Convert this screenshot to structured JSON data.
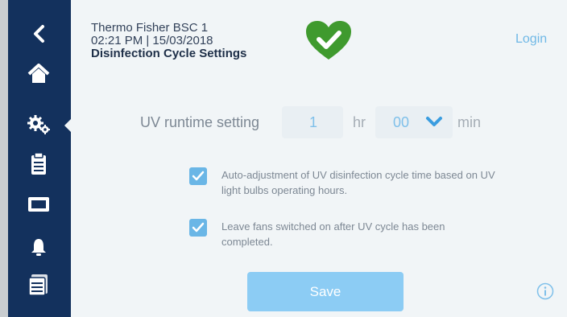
{
  "header": {
    "device_name": "Thermo Fisher BSC 1",
    "datetime": "02:21 PM | 15/03/2018",
    "page_title": "Disinfection Cycle Settings",
    "login": "Login"
  },
  "sidebar": {
    "items": [
      {
        "icon": "back-chevron-icon"
      },
      {
        "icon": "home-icon"
      },
      {
        "icon": "settings-gears-icon",
        "selected": true
      },
      {
        "icon": "clipboard-icon"
      },
      {
        "icon": "display-icon"
      },
      {
        "icon": "bell-icon"
      },
      {
        "icon": "files-icon"
      }
    ]
  },
  "uv_runtime": {
    "label": "UV runtime setting",
    "hours_value": "1",
    "hours_unit": "hr",
    "minutes_value": "00",
    "minutes_unit": "min"
  },
  "options": {
    "auto_adjust": {
      "checked": true,
      "text": "Auto-adjustment of UV disinfection cycle time based on UV light bulbs operating hours."
    },
    "leave_fans_on": {
      "checked": true,
      "text": "Leave fans switched on after UV cycle has been completed."
    }
  },
  "actions": {
    "save_label": "Save"
  },
  "colors": {
    "sidebar": "#13315d",
    "accent_blue": "#6ab6e6",
    "status_green": "#3f9a2e"
  }
}
